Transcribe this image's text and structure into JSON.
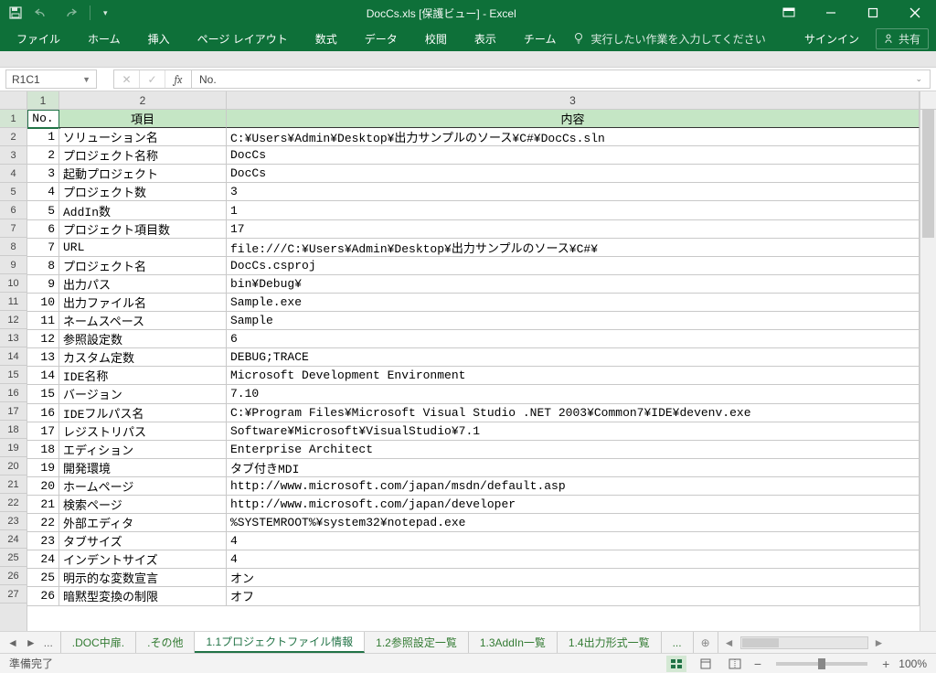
{
  "window": {
    "title": "DocCs.xls  [保護ビュー] - Excel"
  },
  "ribbon": {
    "tabs": [
      {
        "label": "ファイル"
      },
      {
        "label": "ホーム"
      },
      {
        "label": "挿入"
      },
      {
        "label": "ページ レイアウト"
      },
      {
        "label": "数式"
      },
      {
        "label": "データ"
      },
      {
        "label": "校閲"
      },
      {
        "label": "表示"
      },
      {
        "label": "チーム"
      }
    ],
    "tell_me": "実行したい作業を入力してください",
    "signin": "サインイン",
    "share": "共有"
  },
  "fx": {
    "name_box": "R1C1",
    "value": "No."
  },
  "columns": [
    "1",
    "2",
    "3"
  ],
  "headers": {
    "c1": "No.",
    "c2": "項目",
    "c3": "内容"
  },
  "rows": [
    {
      "n": "1",
      "no": "1",
      "item": "ソリューション名",
      "val": "C:¥Users¥Admin¥Desktop¥出力サンプルのソース¥C#¥DocCs.sln"
    },
    {
      "n": "2",
      "no": "2",
      "item": "プロジェクト名称",
      "val": "DocCs"
    },
    {
      "n": "3",
      "no": "3",
      "item": "起動プロジェクト",
      "val": "DocCs"
    },
    {
      "n": "4",
      "no": "4",
      "item": "プロジェクト数",
      "val": "3"
    },
    {
      "n": "5",
      "no": "5",
      "item": "AddIn数",
      "val": "1"
    },
    {
      "n": "6",
      "no": "6",
      "item": "プロジェクト項目数",
      "val": "17"
    },
    {
      "n": "7",
      "no": "7",
      "item": "URL",
      "val": "file:///C:¥Users¥Admin¥Desktop¥出力サンプルのソース¥C#¥"
    },
    {
      "n": "8",
      "no": "8",
      "item": "プロジェクト名",
      "val": "DocCs.csproj"
    },
    {
      "n": "9",
      "no": "9",
      "item": "出力パス",
      "val": "bin¥Debug¥"
    },
    {
      "n": "10",
      "no": "10",
      "item": "出力ファイル名",
      "val": "Sample.exe"
    },
    {
      "n": "11",
      "no": "11",
      "item": "ネームスペース",
      "val": "Sample"
    },
    {
      "n": "12",
      "no": "12",
      "item": "参照設定数",
      "val": "6"
    },
    {
      "n": "13",
      "no": "13",
      "item": "カスタム定数",
      "val": "DEBUG;TRACE"
    },
    {
      "n": "14",
      "no": "14",
      "item": "IDE名称",
      "val": "Microsoft Development Environment"
    },
    {
      "n": "15",
      "no": "15",
      "item": "バージョン",
      "val": "7.10"
    },
    {
      "n": "16",
      "no": "16",
      "item": "IDEフルパス名",
      "val": "C:¥Program Files¥Microsoft Visual Studio .NET 2003¥Common7¥IDE¥devenv.exe"
    },
    {
      "n": "17",
      "no": "17",
      "item": "レジストリパス",
      "val": "Software¥Microsoft¥VisualStudio¥7.1"
    },
    {
      "n": "18",
      "no": "18",
      "item": "エディション",
      "val": "Enterprise Architect"
    },
    {
      "n": "19",
      "no": "19",
      "item": "開発環境",
      "val": "タブ付きMDI"
    },
    {
      "n": "20",
      "no": "20",
      "item": "ホームページ",
      "val": "http://www.microsoft.com/japan/msdn/default.asp"
    },
    {
      "n": "21",
      "no": "21",
      "item": "検索ページ",
      "val": "http://www.microsoft.com/japan/developer"
    },
    {
      "n": "22",
      "no": "22",
      "item": "外部エディタ",
      "val": "%SYSTEMROOT%¥system32¥notepad.exe"
    },
    {
      "n": "23",
      "no": "23",
      "item": "タブサイズ",
      "val": "4"
    },
    {
      "n": "24",
      "no": "24",
      "item": "インデントサイズ",
      "val": "4"
    },
    {
      "n": "25",
      "no": "25",
      "item": "明示的な変数宣言",
      "val": "オン"
    },
    {
      "n": "26",
      "no": "26",
      "item": "暗黙型変換の制限",
      "val": "オフ"
    }
  ],
  "row_labels": [
    "1",
    "2",
    "3",
    "4",
    "5",
    "6",
    "7",
    "8",
    "9",
    "10",
    "11",
    "12",
    "13",
    "14",
    "15",
    "16",
    "17",
    "18",
    "19",
    "20",
    "21",
    "22",
    "23",
    "24",
    "25",
    "26",
    "27"
  ],
  "sheets": {
    "dots": "...",
    "tabs": [
      {
        "label": ".DOC中扉."
      },
      {
        "label": ".その他"
      },
      {
        "label": "1.1プロジェクトファイル情報",
        "active": true
      },
      {
        "label": "1.2参照設定一覧"
      },
      {
        "label": "1.3AddIn一覧"
      },
      {
        "label": "1.4出力形式一覧"
      }
    ],
    "more": "..."
  },
  "status": {
    "ready": "準備完了",
    "zoom": "100%"
  }
}
